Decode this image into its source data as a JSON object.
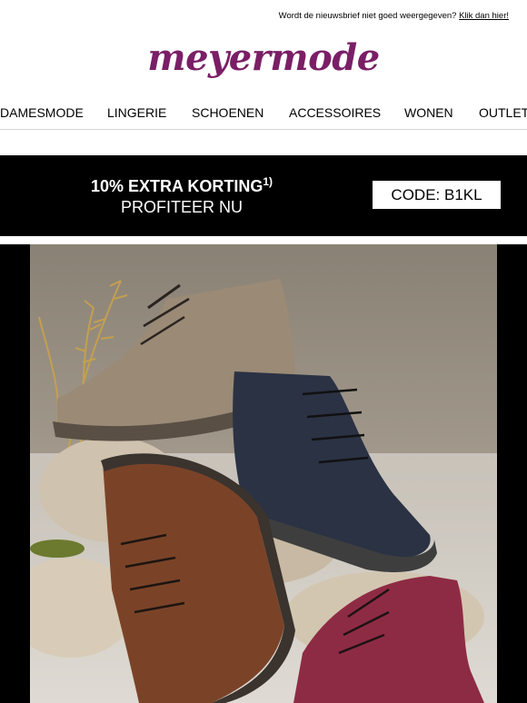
{
  "preheader": {
    "text": "Wordt de nieuwsbrief niet goed weergegeven?",
    "link": "Klik dan hier!"
  },
  "brand": {
    "logo_text": "meyermode",
    "color": "#7a1f66"
  },
  "nav": {
    "items": [
      "DAMESMODE",
      "LINGERIE",
      "SCHOENEN",
      "ACCESSOIRES",
      "WONEN",
      "OUTLET"
    ]
  },
  "promo": {
    "headline": "10% EXTRA KORTING",
    "footnote": "1)",
    "subline": "PROFITEER NU",
    "code": "CODE: B1KL"
  },
  "hero": {
    "boot_colors": [
      "#9a8a76",
      "#2a3244",
      "#7a4328",
      "#8e2b44"
    ]
  }
}
